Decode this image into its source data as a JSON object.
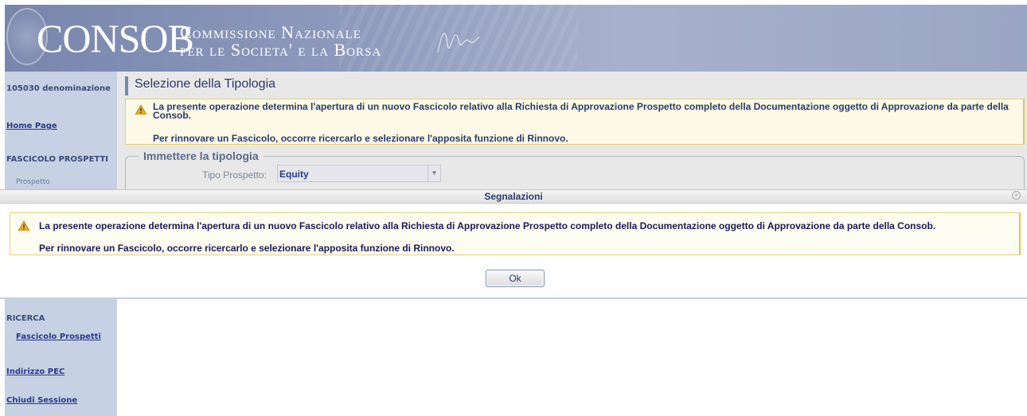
{
  "header": {
    "logo_text": "CONSOB",
    "tagline_line1": "Commissione Nazionale",
    "tagline_line2": "per le Societa' e la Borsa"
  },
  "sidebar": {
    "user": "105030 denominazione",
    "home": "Home Page",
    "section_fascicolo": "FASCICOLO PROSPETTI",
    "item_prospetto": "Prospetto",
    "section_ricerca": "RICERCA",
    "item_fascicolo_prospetti": "Fascicolo Prospetti",
    "indirizzo_pec": "Indirizzo PEC",
    "chiudi_sessione": "Chiudi Sessione"
  },
  "main": {
    "title": "Selezione della Tipologia",
    "warning_line1": "La presente operazione determina l'apertura di un nuovo Fascicolo relativo alla Richiesta di Approvazione Prospetto completo della Documentazione oggetto di Approvazione da parte della Consob.",
    "warning_line2": "Per rinnovare un Fascicolo, occorre ricercarlo e selezionare l'apposita funzione di Rinnovo.",
    "fieldset_legend": "Immettere la tipologia",
    "tipo_label": "Tipo Prospetto:",
    "tipo_value": "Equity"
  },
  "dialog": {
    "title": "Segnalazioni",
    "message_line1": "La presente operazione determina l'apertura di un nuovo Fascicolo relativo alla Richiesta di Approvazione Prospetto completo della Documentazione oggetto di Approvazione da parte della Consob.",
    "message_line2": "Per rinnovare un Fascicolo, occorre ricercarlo e selezionare l'apposita funzione di Rinnovo.",
    "ok_label": "Ok"
  },
  "colors": {
    "banner": "#8e9bbd",
    "sidebar": "#c6d1e3",
    "warning_border": "#e8d070"
  }
}
